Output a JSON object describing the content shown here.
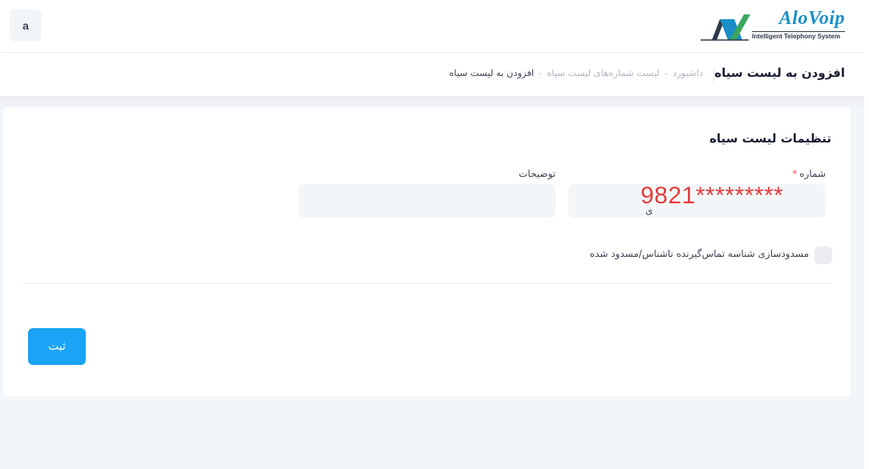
{
  "header": {
    "user_initial": "a",
    "logo": {
      "brand": "AloVoip",
      "tagline": "Intelligent Telephony System",
      "colors": {
        "primary": "#1a8fc7",
        "green": "#3ba55c",
        "dark": "#2b3a4a"
      }
    }
  },
  "subheader": {
    "page_title": "افزودن به لیست سیاه",
    "breadcrumb": [
      {
        "label": "داشبورد"
      },
      {
        "label": "لیست شماره‌های لیست سیاه"
      },
      {
        "label": "افزودن به لیست سیاه"
      }
    ],
    "separator": "-"
  },
  "form": {
    "title": "تنظیمات لیست سیاه",
    "number_field": {
      "label": "شماره",
      "required_mark": "*",
      "value": "",
      "overlay_text": "9821*********",
      "stray_text": "ی"
    },
    "description_field": {
      "label": "توضیحات",
      "value": ""
    },
    "anonymous_checkbox": {
      "label": "مسدودسازی شناسه تماس‌گیرنده ناشناس/مسدود شده",
      "checked": false
    },
    "submit_label": "ثبت"
  },
  "colors": {
    "accent": "#1ba3f5",
    "required": "#f64e60",
    "background": "#f3f6f9",
    "overlay_red": "#e23b3b"
  }
}
